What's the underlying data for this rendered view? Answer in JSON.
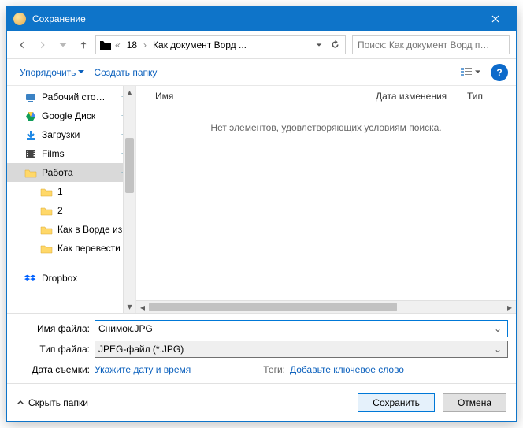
{
  "title": "Сохранение",
  "breadcrumbs": [
    "18",
    "Как документ Ворд ..."
  ],
  "search_placeholder": "Поиск: Как документ Ворд п…",
  "toolbar": {
    "organize": "Упорядочить",
    "new_folder": "Создать папку"
  },
  "columns": {
    "name": "Имя",
    "date": "Дата изменения",
    "type": "Тип"
  },
  "empty_text": "Нет элементов, удовлетворяющих условиям поиска.",
  "tree": [
    {
      "label": "Рабочий сто…",
      "icon": "desktop",
      "pinned": true
    },
    {
      "label": "Google Диск",
      "icon": "gdrive",
      "pinned": true
    },
    {
      "label": "Загрузки",
      "icon": "downloads",
      "pinned": true
    },
    {
      "label": "Films",
      "icon": "film",
      "pinned": true
    },
    {
      "label": "Работа",
      "icon": "folder",
      "pinned": true,
      "selected": true
    },
    {
      "label": "1",
      "icon": "folder",
      "indent": true
    },
    {
      "label": "2",
      "icon": "folder",
      "indent": true
    },
    {
      "label": "Как в Ворде изм",
      "icon": "folder",
      "indent": true
    },
    {
      "label": "Как перевести т",
      "icon": "folder",
      "indent": true
    },
    {
      "label": "Dropbox",
      "icon": "dropbox",
      "top_gap": true
    }
  ],
  "filename_label": "Имя файла:",
  "filename_value": "Снимок.JPG",
  "filetype_label": "Тип файла:",
  "filetype_value": "JPEG-файл (*.JPG)",
  "meta": {
    "date_label": "Дата съемки:",
    "date_link": "Укажите дату и время",
    "tags_label": "Теги:",
    "tags_link": "Добавьте ключевое слово"
  },
  "hide_folders": "Скрыть папки",
  "save": "Сохранить",
  "cancel": "Отмена"
}
